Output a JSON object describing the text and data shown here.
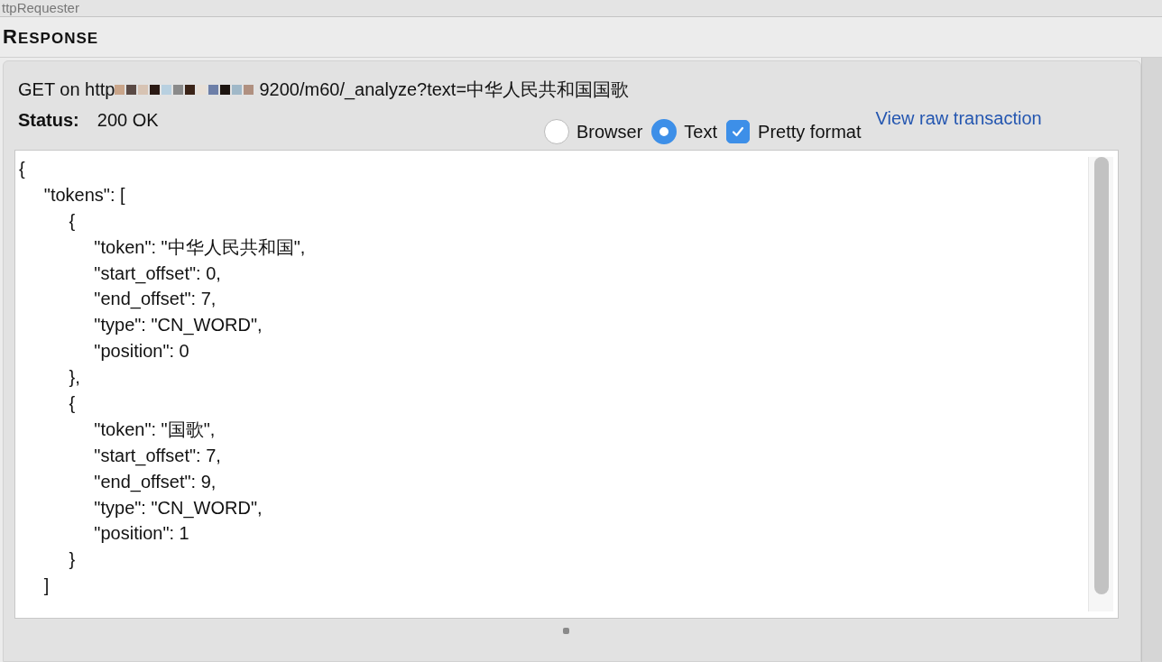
{
  "window": {
    "title": "ttpRequester"
  },
  "response": {
    "heading": "RESPONSE",
    "request_prefix": "GET on http",
    "request_rest": "9200/m60/_analyze?text=中华人民共和国国歌",
    "status_label": "Status:",
    "status_value": "200 OK",
    "view_options": [
      {
        "label": "Browser",
        "kind": "radio",
        "selected": false
      },
      {
        "label": "Text",
        "kind": "radio",
        "selected": true
      },
      {
        "label": "Pretty format",
        "kind": "checkbox",
        "checked": true
      }
    ],
    "raw_link": "View raw transaction",
    "body_lines": [
      "{",
      "     \"tokens\": [",
      "          {",
      "               \"token\": \"中华人民共和国\",",
      "               \"start_offset\": 0,",
      "               \"end_offset\": 7,",
      "               \"type\": \"CN_WORD\",",
      "               \"position\": 0",
      "          },",
      "          {",
      "               \"token\": \"国歌\",",
      "               \"start_offset\": 7,",
      "               \"end_offset\": 9,",
      "               \"type\": \"CN_WORD\",",
      "               \"position\": 1",
      "          }",
      "     ]"
    ]
  }
}
